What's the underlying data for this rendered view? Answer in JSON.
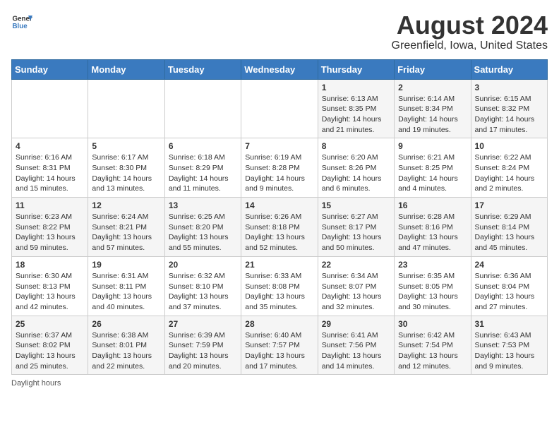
{
  "header": {
    "logo_line1": "General",
    "logo_line2": "Blue",
    "title": "August 2024",
    "subtitle": "Greenfield, Iowa, United States"
  },
  "days_of_week": [
    "Sunday",
    "Monday",
    "Tuesday",
    "Wednesday",
    "Thursday",
    "Friday",
    "Saturday"
  ],
  "weeks": [
    [
      {
        "num": "",
        "info": ""
      },
      {
        "num": "",
        "info": ""
      },
      {
        "num": "",
        "info": ""
      },
      {
        "num": "",
        "info": ""
      },
      {
        "num": "1",
        "info": "Sunrise: 6:13 AM\nSunset: 8:35 PM\nDaylight: 14 hours\nand 21 minutes."
      },
      {
        "num": "2",
        "info": "Sunrise: 6:14 AM\nSunset: 8:34 PM\nDaylight: 14 hours\nand 19 minutes."
      },
      {
        "num": "3",
        "info": "Sunrise: 6:15 AM\nSunset: 8:32 PM\nDaylight: 14 hours\nand 17 minutes."
      }
    ],
    [
      {
        "num": "4",
        "info": "Sunrise: 6:16 AM\nSunset: 8:31 PM\nDaylight: 14 hours\nand 15 minutes."
      },
      {
        "num": "5",
        "info": "Sunrise: 6:17 AM\nSunset: 8:30 PM\nDaylight: 14 hours\nand 13 minutes."
      },
      {
        "num": "6",
        "info": "Sunrise: 6:18 AM\nSunset: 8:29 PM\nDaylight: 14 hours\nand 11 minutes."
      },
      {
        "num": "7",
        "info": "Sunrise: 6:19 AM\nSunset: 8:28 PM\nDaylight: 14 hours\nand 9 minutes."
      },
      {
        "num": "8",
        "info": "Sunrise: 6:20 AM\nSunset: 8:26 PM\nDaylight: 14 hours\nand 6 minutes."
      },
      {
        "num": "9",
        "info": "Sunrise: 6:21 AM\nSunset: 8:25 PM\nDaylight: 14 hours\nand 4 minutes."
      },
      {
        "num": "10",
        "info": "Sunrise: 6:22 AM\nSunset: 8:24 PM\nDaylight: 14 hours\nand 2 minutes."
      }
    ],
    [
      {
        "num": "11",
        "info": "Sunrise: 6:23 AM\nSunset: 8:22 PM\nDaylight: 13 hours\nand 59 minutes."
      },
      {
        "num": "12",
        "info": "Sunrise: 6:24 AM\nSunset: 8:21 PM\nDaylight: 13 hours\nand 57 minutes."
      },
      {
        "num": "13",
        "info": "Sunrise: 6:25 AM\nSunset: 8:20 PM\nDaylight: 13 hours\nand 55 minutes."
      },
      {
        "num": "14",
        "info": "Sunrise: 6:26 AM\nSunset: 8:18 PM\nDaylight: 13 hours\nand 52 minutes."
      },
      {
        "num": "15",
        "info": "Sunrise: 6:27 AM\nSunset: 8:17 PM\nDaylight: 13 hours\nand 50 minutes."
      },
      {
        "num": "16",
        "info": "Sunrise: 6:28 AM\nSunset: 8:16 PM\nDaylight: 13 hours\nand 47 minutes."
      },
      {
        "num": "17",
        "info": "Sunrise: 6:29 AM\nSunset: 8:14 PM\nDaylight: 13 hours\nand 45 minutes."
      }
    ],
    [
      {
        "num": "18",
        "info": "Sunrise: 6:30 AM\nSunset: 8:13 PM\nDaylight: 13 hours\nand 42 minutes."
      },
      {
        "num": "19",
        "info": "Sunrise: 6:31 AM\nSunset: 8:11 PM\nDaylight: 13 hours\nand 40 minutes."
      },
      {
        "num": "20",
        "info": "Sunrise: 6:32 AM\nSunset: 8:10 PM\nDaylight: 13 hours\nand 37 minutes."
      },
      {
        "num": "21",
        "info": "Sunrise: 6:33 AM\nSunset: 8:08 PM\nDaylight: 13 hours\nand 35 minutes."
      },
      {
        "num": "22",
        "info": "Sunrise: 6:34 AM\nSunset: 8:07 PM\nDaylight: 13 hours\nand 32 minutes."
      },
      {
        "num": "23",
        "info": "Sunrise: 6:35 AM\nSunset: 8:05 PM\nDaylight: 13 hours\nand 30 minutes."
      },
      {
        "num": "24",
        "info": "Sunrise: 6:36 AM\nSunset: 8:04 PM\nDaylight: 13 hours\nand 27 minutes."
      }
    ],
    [
      {
        "num": "25",
        "info": "Sunrise: 6:37 AM\nSunset: 8:02 PM\nDaylight: 13 hours\nand 25 minutes."
      },
      {
        "num": "26",
        "info": "Sunrise: 6:38 AM\nSunset: 8:01 PM\nDaylight: 13 hours\nand 22 minutes."
      },
      {
        "num": "27",
        "info": "Sunrise: 6:39 AM\nSunset: 7:59 PM\nDaylight: 13 hours\nand 20 minutes."
      },
      {
        "num": "28",
        "info": "Sunrise: 6:40 AM\nSunset: 7:57 PM\nDaylight: 13 hours\nand 17 minutes."
      },
      {
        "num": "29",
        "info": "Sunrise: 6:41 AM\nSunset: 7:56 PM\nDaylight: 13 hours\nand 14 minutes."
      },
      {
        "num": "30",
        "info": "Sunrise: 6:42 AM\nSunset: 7:54 PM\nDaylight: 13 hours\nand 12 minutes."
      },
      {
        "num": "31",
        "info": "Sunrise: 6:43 AM\nSunset: 7:53 PM\nDaylight: 13 hours\nand 9 minutes."
      }
    ]
  ],
  "footer": "Daylight hours"
}
